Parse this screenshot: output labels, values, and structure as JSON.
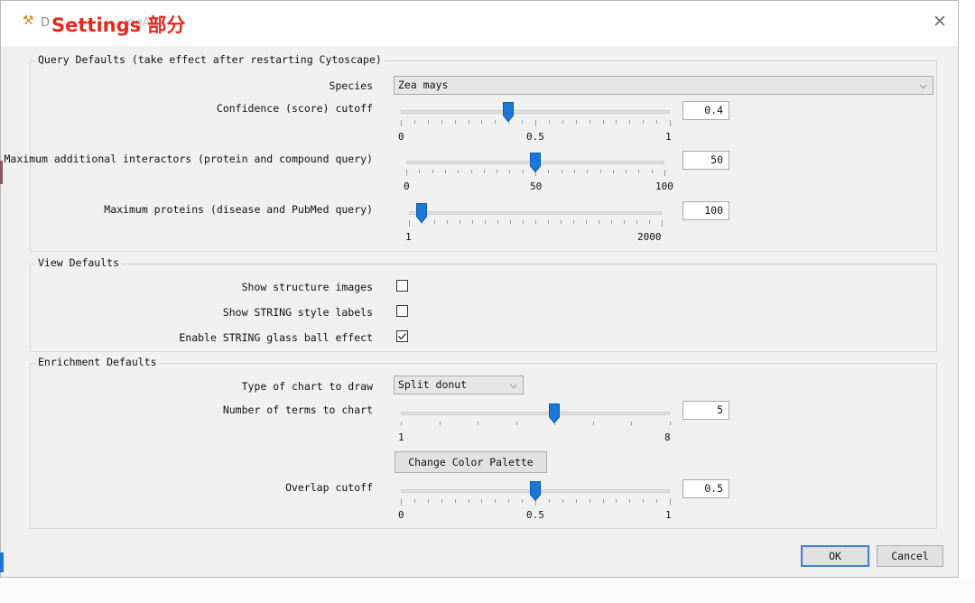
{
  "window": {
    "app_icon": "settings-wrench-icon",
    "faded_title": "D                    ingApp",
    "overlay_title": "Settings 部分",
    "close_glyph": "✕"
  },
  "query_defaults": {
    "title": "Query Defaults (take effect after restarting Cytoscape)",
    "species_label": "Species",
    "species_value": "Zea mays",
    "confidence": {
      "label": "Confidence (score) cutoff",
      "value": "0.4",
      "min_label": "0",
      "mid_label": "0.5",
      "max_label": "1",
      "level": 0.4
    },
    "max_interactors": {
      "label": "Maximum additional interactors (protein and compound query)",
      "value": "50",
      "min_label": "0",
      "mid_label": "50",
      "max_label": "100",
      "level": 0.5
    },
    "max_proteins": {
      "label": "Maximum proteins (disease and PubMed query)",
      "value": "100",
      "min_label": "1",
      "max_label": "2000",
      "level": 0.05
    }
  },
  "view_defaults": {
    "title": "View Defaults",
    "show_structure_label": "Show structure images",
    "show_structure_checked": false,
    "show_string_label": "Show STRING style labels",
    "show_string_checked": false,
    "glass_ball_label": "Enable STRING glass ball effect",
    "glass_ball_checked": true
  },
  "enrichment_defaults": {
    "title": "Enrichment Defaults",
    "chart_type_label": "Type of chart to draw",
    "chart_type_value": "Split donut",
    "num_terms": {
      "label": "Number of terms to chart",
      "value": "5",
      "min_label": "1",
      "max_label": "8",
      "level": 0.5714
    },
    "change_palette_label": "Change Color Palette",
    "overlap": {
      "label": "Overlap cutoff",
      "value": "0.5",
      "min_label": "0",
      "mid_label": "0.5",
      "max_label": "1",
      "level": 0.5
    }
  },
  "footer": {
    "ok_label": "OK",
    "cancel_label": "Cancel"
  },
  "colors": {
    "thumb": "#1a78d8",
    "title_overlay": "#e8281e",
    "default_button_border": "#3c7fd8"
  }
}
